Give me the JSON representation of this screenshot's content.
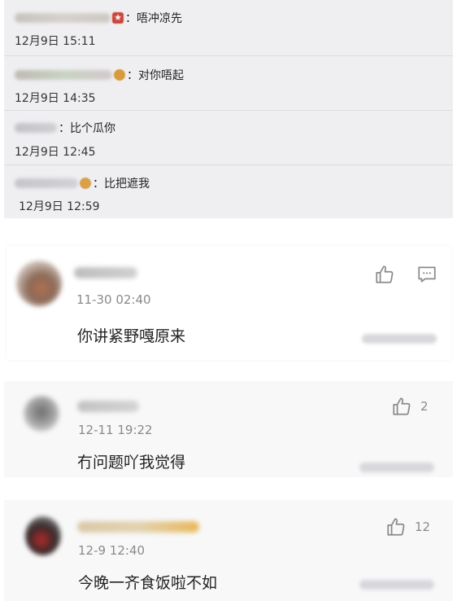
{
  "replies": [
    {
      "text": "：唔冲凉先",
      "time": "12月9日 15:11"
    },
    {
      "text": "：对你唔起",
      "time": "12月9日 14:35"
    },
    {
      "text": "：比个瓜你",
      "time": "12月9日 12:45"
    },
    {
      "text": "：比把遮我",
      "time": "12月9日 12:59"
    }
  ],
  "comments": [
    {
      "time": "11-30 02:40",
      "text": "你讲紧野嘎原来",
      "like_count": ""
    },
    {
      "time": "12-11 19:22",
      "text": "冇问题吖我觉得",
      "like_count": "2"
    },
    {
      "time": "12-9 12:40",
      "text": "今晚一齐食饭啦不如",
      "like_count": "12"
    }
  ],
  "icons": {
    "like": "thumbs-up-icon",
    "reply": "comment-icon"
  },
  "colors": {
    "reply_bg": "#efeff2",
    "time_gray": "#8a8a8a",
    "text": "#222222"
  }
}
